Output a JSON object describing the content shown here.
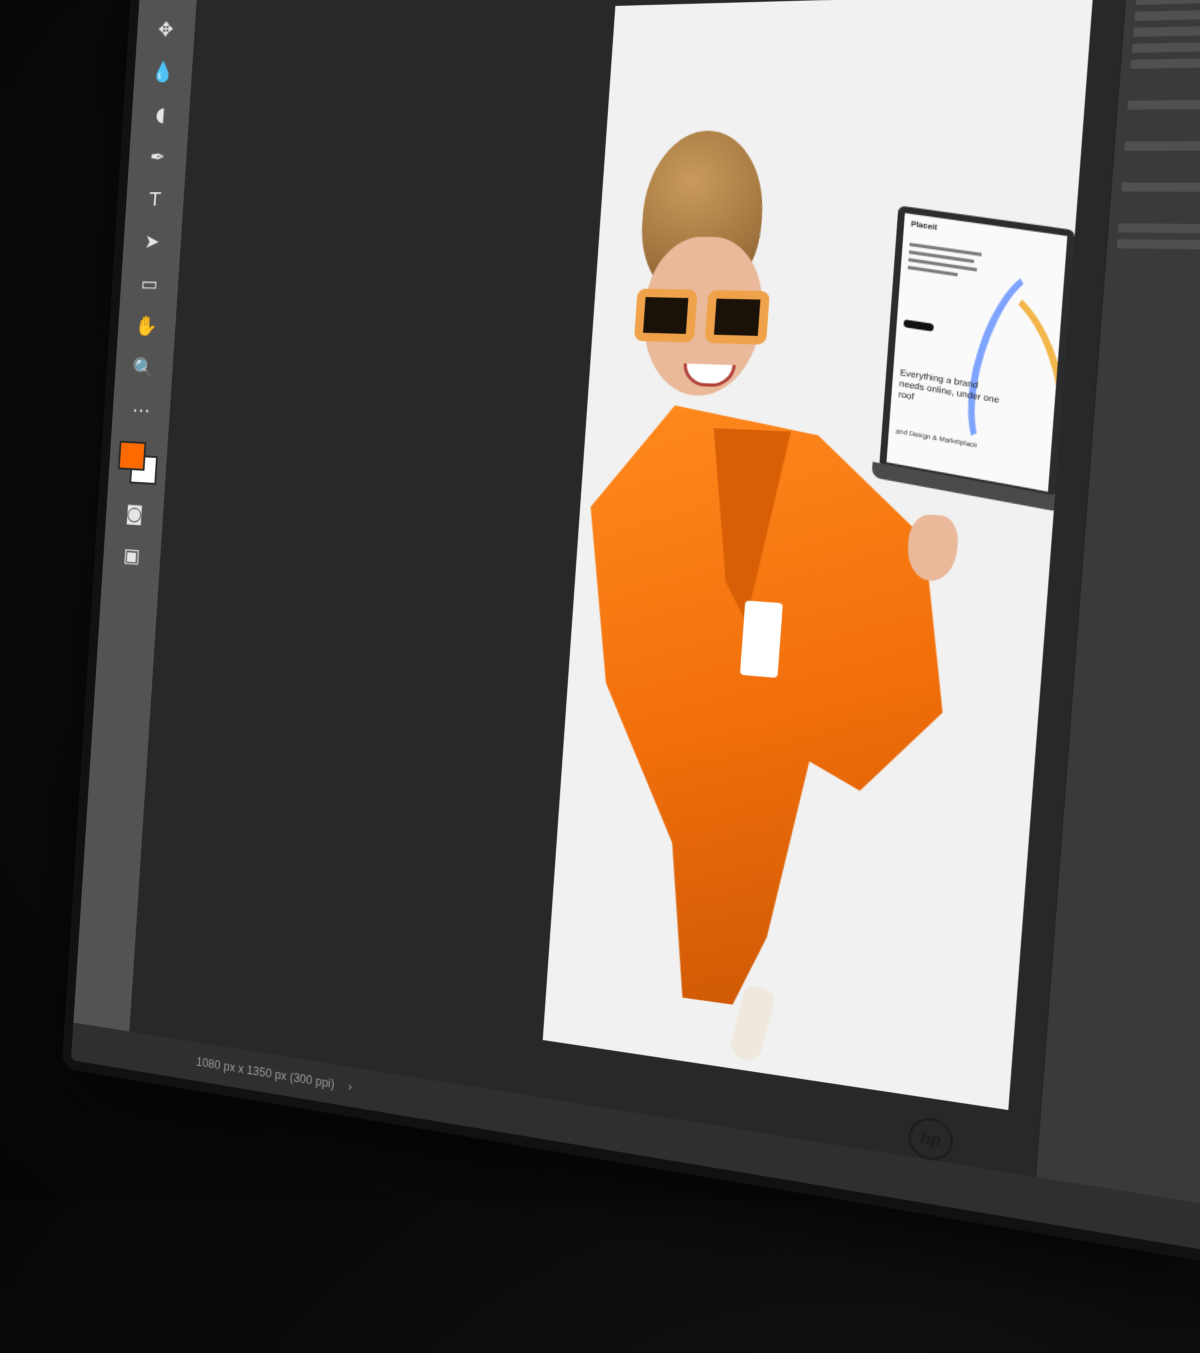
{
  "app": {
    "menu": [
      "",
      "",
      "",
      "",
      "",
      ""
    ]
  },
  "toolbar": {
    "tools": [
      {
        "name": "move-tool-icon",
        "glyph": "✥"
      },
      {
        "name": "blur-tool-icon",
        "glyph": "💧"
      },
      {
        "name": "dodge-tool-icon",
        "glyph": "◖"
      },
      {
        "name": "pen-tool-icon",
        "glyph": "✒"
      },
      {
        "name": "type-tool-icon",
        "glyph": "T"
      },
      {
        "name": "path-selection-tool-icon",
        "glyph": "➤"
      },
      {
        "name": "rectangle-tool-icon",
        "glyph": "▭"
      },
      {
        "name": "hand-tool-icon",
        "glyph": "✋"
      },
      {
        "name": "zoom-tool-icon",
        "glyph": "🔍"
      },
      {
        "name": "more-tools-icon",
        "glyph": "⋯"
      }
    ],
    "foreground_color": "#ff6a00",
    "background_color": "#ffffff"
  },
  "document": {
    "laptop_screen": {
      "brand": "Placeit",
      "tagline": "Everything a brand needs online, under one roof",
      "footer": "and Design & Marketplace"
    }
  },
  "statusbar": {
    "dimensions": "1080 px x 1350 px (300 ppi)",
    "chevron": "›"
  },
  "colors": {
    "suit": "#f26f0b",
    "canvas_bg": "#f1f1f1",
    "app_bg": "#282828"
  }
}
